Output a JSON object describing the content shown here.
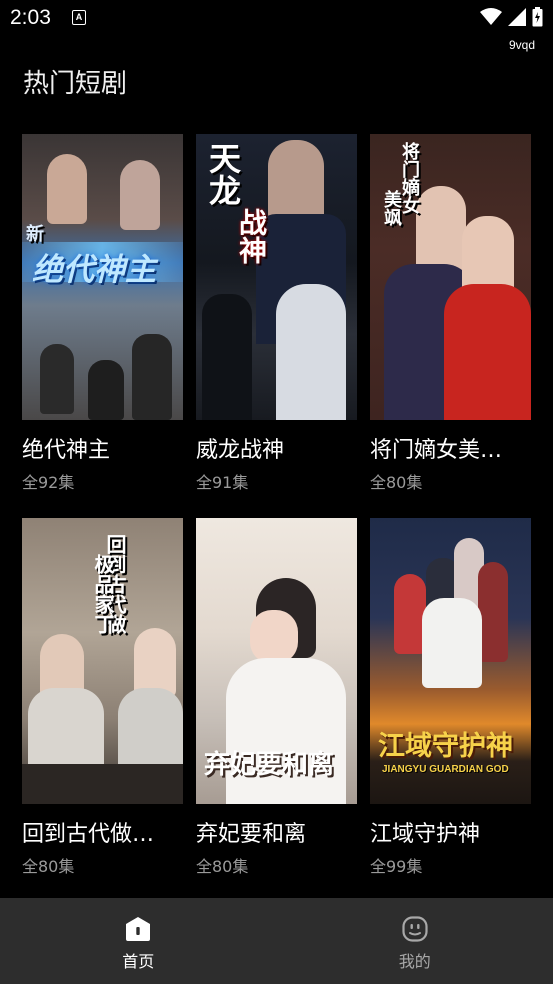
{
  "status": {
    "time": "2:03",
    "tag": "9vqd"
  },
  "page": {
    "title": "热门短剧"
  },
  "dramas": [
    {
      "title": "绝代神主",
      "count": "全92集",
      "poster_text": "绝代神主",
      "poster_text_2": "新"
    },
    {
      "title": "威龙战神",
      "count": "全91集",
      "poster_text": "天龙",
      "poster_text_2": "战神"
    },
    {
      "title": "将门嫡女美…",
      "count": "全80集",
      "poster_text": "将门嫡女",
      "poster_text_2": "美飒"
    },
    {
      "title": "回到古代做…",
      "count": "全80集",
      "poster_text": "回到古代做",
      "poster_text_2": "极品家丁"
    },
    {
      "title": "弃妃要和离",
      "count": "全80集",
      "poster_text": "弃妃要和离",
      "poster_text_2": ""
    },
    {
      "title": "江域守护神",
      "count": "全99集",
      "poster_text": "江域守护神",
      "poster_text_2": "JIANGYU GUARDIAN GOD"
    }
  ],
  "nav": {
    "home_label": "首页",
    "mine_label": "我的",
    "home_icon": "home-icon",
    "mine_icon": "profile-face-icon",
    "active_color": "#ffffff",
    "inactive_color": "#a8a8a8"
  }
}
